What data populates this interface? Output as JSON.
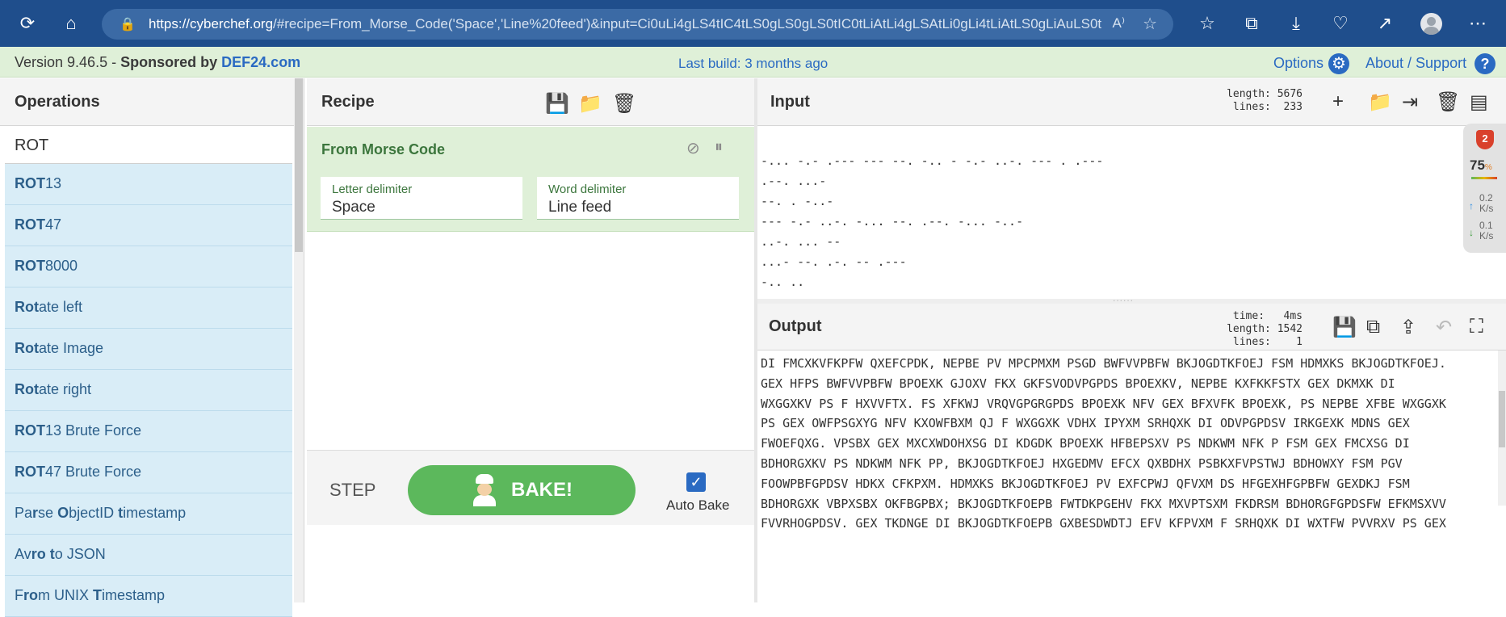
{
  "browser": {
    "url_host": "https://cyberchef.org",
    "url_rest": "/#recipe=From_Morse_Code('Space','Line%20feed')&input=Ci0uLi4gLS4tIC4tLS0gLS0gLS0tIC0tLiAtLi4gLSAtLi0gLi4tLiAtLS0gLiAuLS0tCi...",
    "read_aloud": "A⁾"
  },
  "version_bar": {
    "version": "Version 9.46.5",
    "sponsored": "Sponsored",
    "by": "by",
    "sponsor": "DEF24.com",
    "last_build": "Last build: 3 months ago",
    "options": "Options",
    "about": "About / Support"
  },
  "operations": {
    "title": "Operations",
    "search_value": "ROT",
    "items": [
      {
        "bold": "ROT",
        "rest": "13"
      },
      {
        "bold": "ROT",
        "rest": "47"
      },
      {
        "bold": "ROT",
        "rest": "8000"
      },
      {
        "bold": "Rot",
        "rest": "ate left"
      },
      {
        "bold": "Rot",
        "rest": "ate Image"
      },
      {
        "bold": "Rot",
        "rest": "ate right"
      },
      {
        "bold": "ROT",
        "rest": "13 Brute Force"
      },
      {
        "bold": "ROT",
        "rest": "47 Brute Force"
      },
      {
        "html": "Pa<b>r</b>se <b>O</b>bjectID <b>t</b>imestamp"
      },
      {
        "html": "Av<b>ro</b> <b>t</b>o JSON"
      },
      {
        "html": "F<b>ro</b>m UNIX <b>T</b>imestamp"
      }
    ]
  },
  "recipe": {
    "title": "Recipe",
    "ingredient": {
      "name": "From Morse Code",
      "letter_label": "Letter delimiter",
      "letter_value": "Space",
      "word_label": "Word delimiter",
      "word_value": "Line feed"
    },
    "step": "STEP",
    "bake": "BAKE!",
    "auto_bake": "Auto Bake"
  },
  "input": {
    "title": "Input",
    "meta": "length: 5676\n lines:  233",
    "lines": [
      "-... -.- .--- --- --. -.. - -.- ..-. --- . .---",
      ".--. ...-",
      "--. . -..-",
      "--- -.- ..-. -... --. .--. -... -..-",
      "..-. ... --",
      "...- --. .-. -- .---",
      "-.. .."
    ]
  },
  "output": {
    "title": "Output",
    "meta": "time:   4ms\nlength: 1542\n lines:    1",
    "lines": [
      "DI FMCXKVFKPFW QXEFCPDK, NEPBE PV MPCPMXM PSGD BWFVVPBFW BKJOGDTKFOEJ FSM HDMXKS BKJOGDTKFOEJ.",
      "GEX HFPS BWFVVPBFW BPOEXK GJOXV FKX GKFSVODVPGPDS BPOEXKV, NEPBE KXFKKFSTX GEX DKMXK DI",
      "WXGGXKV PS F HXVVFTX. FS XFKWJ VRQVGPGRGPDS BPOEXK NFV GEX BFXVFK BPOEXK, PS NEPBE XFBE WXGGXK",
      "PS GEX OWFPSGXYG NFV KXOWFBXM QJ F WXGGXK VDHX IPYXM SRHQXK DI ODVPGPDSV IRKGEXK MDNS GEX",
      "FWOEFQXG. VPSBX GEX MXCXWDOHXSG DI KDGDK BPOEXK HFBEPSXV PS NDKWM NFK P FSM GEX FMCXSG DI",
      "BDHORGXKV PS NDKWM NFK PP, BKJOGDTKFOEJ HXGEDMV EFCX QXBDHX PSBKXFVPSTWJ BDHOWXY FSM PGV",
      "FOOWPBFGPDSV HDKX CFKPXM. HDMXKS BKJOGDTKFOEJ PV EXFCPWJ QFVXM DS HFGEXHFGPBFW GEXDKJ FSM",
      "BDHORGXK VBPXSBX OKFBGPBX; BKJOGDTKFOEPB FWTDKPGEHV FKX MXVPTSXM FKDRSM BDHORGFGPDSFW EFKMSXVV",
      "FVVRHOGPDSV. GEX TKDNGE DI BKJOGDTKFOEPB GXBESDWDTJ EFV KFPVXM F SRHQXK DI WXTFW PVVRXV PS GEX"
    ]
  },
  "widget": {
    "badge": "2",
    "percent": "75",
    "percent_unit": "%",
    "up": "0.2",
    "down": "0.1",
    "unit": "K/s"
  }
}
